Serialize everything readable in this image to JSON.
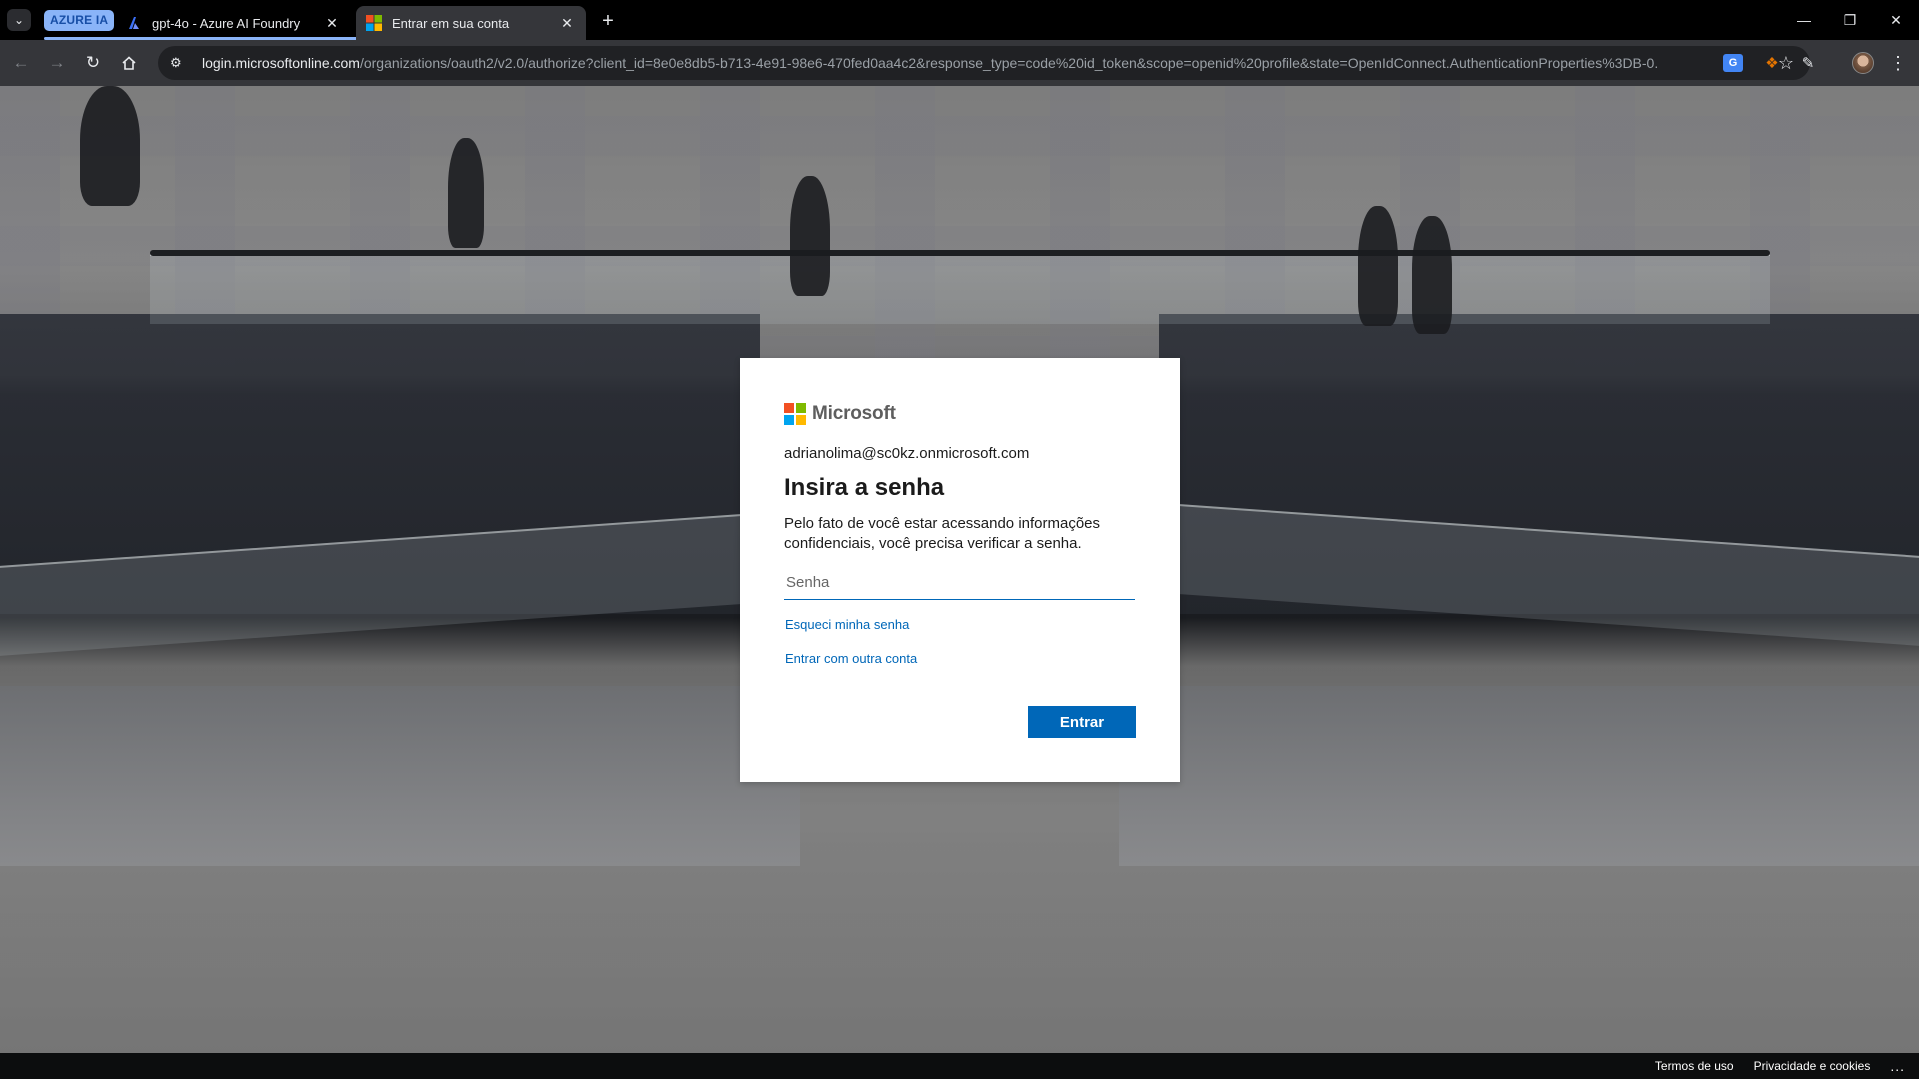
{
  "browser": {
    "tab_group_label": "AZURE IA",
    "tabs": [
      {
        "title": "gpt-4o - Azure AI Foundry",
        "favicon": "azure-ai-foundry-icon"
      },
      {
        "title": "Entrar em sua conta",
        "favicon": "microsoft-logo-icon",
        "active": true
      }
    ],
    "url_host": "login.microsoftonline.com",
    "url_path": "/organizations/oauth2/v2.0/authorize?client_id=8e0e8db5-b713-4e91-98e6-470fed0aa4c2&response_type=code%20id_token&scope=openid%20profile&state=OpenIdConnect.AuthenticationProperties%3DB-0..."
  },
  "signin": {
    "brand": "Microsoft",
    "brand_colors": [
      "#f25022",
      "#7fba00",
      "#00a4ef",
      "#ffb900"
    ],
    "email": "adrianolima@sc0kz.onmicrosoft.com",
    "heading": "Insira a senha",
    "description": "Pelo fato de você estar acessando informações confidenciais, você precisa verificar a senha.",
    "password_placeholder": "Senha",
    "forgot_link": "Esqueci minha senha",
    "other_account_link": "Entrar com outra conta",
    "submit_label": "Entrar",
    "accent_color": "#0067b8"
  },
  "footer": {
    "terms": "Termos de uso",
    "privacy": "Privacidade e cookies",
    "more": "..."
  }
}
